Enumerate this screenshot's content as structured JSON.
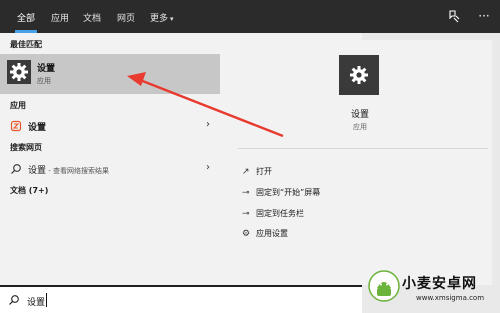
{
  "topbar": {
    "tabs": [
      "全部",
      "应用",
      "文档",
      "网页",
      "更多"
    ],
    "more_caret": "▾"
  },
  "left": {
    "best_match_header": "最佳匹配",
    "best_match": {
      "title": "设置",
      "subtitle": "应用"
    },
    "apps_header": "应用",
    "apps_item": "设置",
    "web_header": "搜索网页",
    "web_item": {
      "query": "设置",
      "suffix": " - 查看网络搜索结果"
    },
    "docs_header": "文档 (7+)"
  },
  "detail": {
    "title": "设置",
    "subtitle": "应用",
    "actions": [
      "打开",
      "固定到“开始”屏幕",
      "固定到任务栏",
      "应用设置"
    ]
  },
  "search": {
    "value": "设置"
  },
  "watermark": {
    "name": "小麦安卓网",
    "url": "www.xmsigma.com"
  },
  "colors": {
    "accent": "#4aa0e6",
    "arrow": "#e83a2e",
    "selection": "#c7c7c7",
    "icon_tile": "#3a3a3a"
  }
}
